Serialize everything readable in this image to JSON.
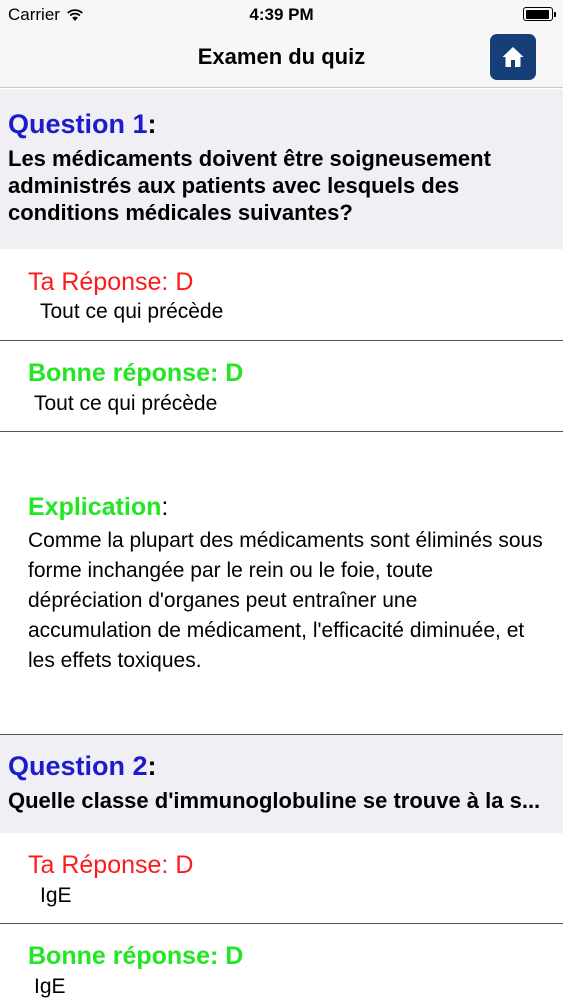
{
  "status_bar": {
    "carrier": "Carrier",
    "time": "4:39 PM",
    "icons": [
      "wifi-icon",
      "battery-icon"
    ]
  },
  "nav": {
    "title": "Examen du quiz",
    "home_icon": "home-icon",
    "home_color": "#163f78"
  },
  "questions": [
    {
      "label": "Question 1",
      "colon": ":",
      "text": " Les médicaments doivent être soigneusement administrés aux patients avec lesquels des conditions médicales suivantes?",
      "your_answer_label": "Ta Réponse: D",
      "your_answer_text": "Tout ce qui précède",
      "correct_answer_label": "Bonne réponse: D",
      "correct_answer_text": "Tout ce qui précède",
      "explanation_label": "Explication",
      "explanation_colon": ":",
      "explanation_text": " Comme la plupart des médicaments sont éliminés sous forme inchangée par le rein ou le foie, toute dépréciation d'organes peut entraîner une accumulation de médicament, l'efficacité diminuée, et les effets toxiques."
    },
    {
      "label": "Question 2",
      "colon": ":",
      "text": " Quelle classe d'immunoglobuline se trouve à la s...",
      "your_answer_label": "Ta Réponse: D",
      "your_answer_text": "IgE",
      "correct_answer_label": "Bonne réponse: D",
      "correct_answer_text": "IgE"
    }
  ],
  "colors": {
    "question_label": "#1c1ccc",
    "your_answer": "#ff1a1a",
    "correct_answer": "#22e622",
    "section_background": "#efeff4"
  }
}
